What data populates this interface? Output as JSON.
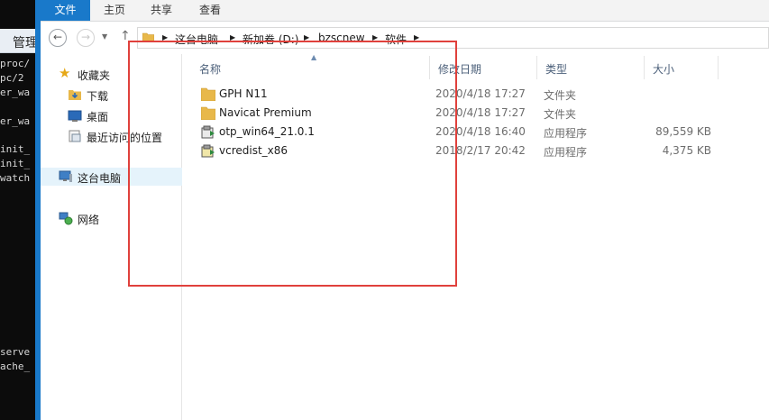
{
  "terminal": {
    "header_text": "管理",
    "lines": [
      "proc/",
      "pc/2",
      "er_wa",
      "er_wa",
      "init_",
      "init_",
      "watch",
      "serve",
      "ache_"
    ]
  },
  "ribbon": {
    "tabs": [
      "文件",
      "主页",
      "共享",
      "查看"
    ]
  },
  "address": {
    "crumbs": [
      "这台电脑",
      "新加卷 (D:)",
      "bzscnew",
      "软件"
    ]
  },
  "nav": {
    "favorites": "收藏夹",
    "downloads": "下载",
    "desktop": "桌面",
    "recent": "最近访问的位置",
    "this_pc": "这台电脑",
    "network": "网络"
  },
  "columns": {
    "name": "名称",
    "date": "修改日期",
    "type": "类型",
    "size": "大小"
  },
  "files": [
    {
      "name": "GPH N11",
      "date": "2020/4/18 17:27",
      "type": "文件夹",
      "size": "",
      "icon": "folder-icon"
    },
    {
      "name": "Navicat Premium",
      "date": "2020/4/18 17:27",
      "type": "文件夹",
      "size": "",
      "icon": "folder-icon"
    },
    {
      "name": "otp_win64_21.0.1",
      "date": "2020/4/18 16:40",
      "type": "应用程序",
      "size": "89,559 KB",
      "icon": "installer-icon"
    },
    {
      "name": "vcredist_x86",
      "date": "2018/2/17 20:42",
      "type": "应用程序",
      "size": "4,375 KB",
      "icon": "installer-icon"
    }
  ],
  "colors": {
    "accent_blue": "#1979ca",
    "annotation_red": "#e0413c",
    "folder_yellow": "#e8b84a"
  }
}
